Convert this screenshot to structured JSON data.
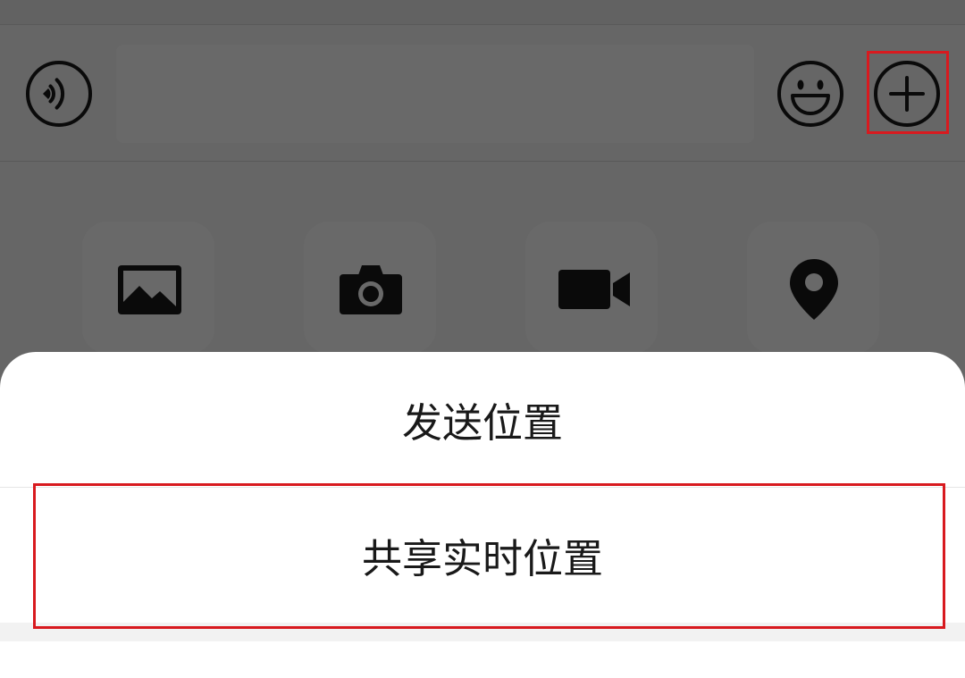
{
  "colors": {
    "highlight_red": "#d81a1f",
    "dim_overlay": "rgba(0,0,0,0.59)",
    "sheet_background": "#ffffff",
    "icon_color": "#1a1a1a"
  },
  "input_bar": {
    "voice_button_icon": "voice-icon",
    "message_value": "",
    "emoji_button_icon": "emoji-icon",
    "more_button_icon": "plus-circle-icon"
  },
  "tool_panel": {
    "tools": [
      {
        "icon": "album-icon"
      },
      {
        "icon": "camera-icon"
      },
      {
        "icon": "video-call-icon"
      },
      {
        "icon": "location-icon"
      }
    ]
  },
  "location_sheet": {
    "options": [
      {
        "label": "发送位置"
      },
      {
        "label": "共享实时位置"
      }
    ]
  }
}
